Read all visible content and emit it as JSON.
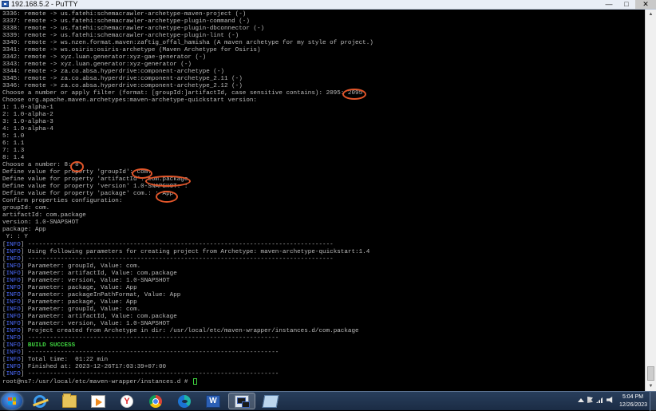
{
  "window": {
    "title": "192.168.5.2 - PuTTY",
    "controls": {
      "minimize": "—",
      "maximize": "□",
      "close": "✕"
    }
  },
  "terminal": {
    "lines": [
      {
        "parts": [
          {
            "text": "3336: remote -> us.fatehi:schemacrawler-archetype-maven-project (-)"
          }
        ]
      },
      {
        "parts": [
          {
            "text": "3337: remote -> us.fatehi:schemacrawler-archetype-plugin-command (-)"
          }
        ]
      },
      {
        "parts": [
          {
            "text": "3338: remote -> us.fatehi:schemacrawler-archetype-plugin-dbconnector (-)"
          }
        ]
      },
      {
        "parts": [
          {
            "text": "3339: remote -> us.fatehi:schemacrawler-archetype-plugin-lint (-)"
          }
        ]
      },
      {
        "parts": [
          {
            "text": "3340: remote -> ws.nzen.format.maven:zaftig_offal_hamisha (A maven archetype for my style of project.)"
          }
        ]
      },
      {
        "parts": [
          {
            "text": "3341: remote -> ws.osiris:osiris-archetype (Maven Archetype for Osiris)"
          }
        ]
      },
      {
        "parts": [
          {
            "text": "3342: remote -> xyz.luan.generator:xyz-gae-generator (-)"
          }
        ]
      },
      {
        "parts": [
          {
            "text": "3343: remote -> xyz.luan.generator:xyz-generator (-)"
          }
        ]
      },
      {
        "parts": [
          {
            "text": "3344: remote -> za.co.absa.hyperdrive:component-archetype (-)"
          }
        ]
      },
      {
        "parts": [
          {
            "text": "3345: remote -> za.co.absa.hyperdrive:component-archetype_2.11 (-)"
          }
        ]
      },
      {
        "parts": [
          {
            "text": "3346: remote -> za.co.absa.hyperdrive:component-archetype_2.12 (-)"
          }
        ]
      },
      {
        "parts": [
          {
            "text": "Choose a number or apply filter (format: [groupId:]artifactId, case sensitive contains): 2095: 2095"
          }
        ]
      },
      {
        "parts": [
          {
            "text": "Choose org.apache.maven.archetypes:maven-archetype-quickstart version:"
          }
        ]
      },
      {
        "parts": [
          {
            "text": "1: 1.0-alpha-1"
          }
        ]
      },
      {
        "parts": [
          {
            "text": "2: 1.0-alpha-2"
          }
        ]
      },
      {
        "parts": [
          {
            "text": "3: 1.0-alpha-3"
          }
        ]
      },
      {
        "parts": [
          {
            "text": "4: 1.0-alpha-4"
          }
        ]
      },
      {
        "parts": [
          {
            "text": "5: 1.0"
          }
        ]
      },
      {
        "parts": [
          {
            "text": "6: 1.1"
          }
        ]
      },
      {
        "parts": [
          {
            "text": "7: 1.3"
          }
        ]
      },
      {
        "parts": [
          {
            "text": "8: 1.4"
          }
        ]
      },
      {
        "parts": [
          {
            "text": "Choose a number: 8: 8"
          }
        ]
      },
      {
        "parts": [
          {
            "text": "Define value for property 'groupId': com."
          }
        ]
      },
      {
        "parts": [
          {
            "text": "Define value for property 'artifactId': com.package"
          }
        ]
      },
      {
        "parts": [
          {
            "text": "Define value for property 'version' 1.0-SNAPSHOT: :"
          }
        ]
      },
      {
        "parts": [
          {
            "text": "Define value for property 'package' com.: : App"
          }
        ]
      },
      {
        "parts": [
          {
            "text": "Confirm properties configuration:"
          }
        ]
      },
      {
        "parts": [
          {
            "text": "groupId: com."
          }
        ]
      },
      {
        "parts": [
          {
            "text": "artifactId: com.package"
          }
        ]
      },
      {
        "parts": [
          {
            "text": "version: 1.0-SNAPSHOT"
          }
        ]
      },
      {
        "parts": [
          {
            "text": "package: App"
          }
        ]
      },
      {
        "parts": [
          {
            "text": " Y: : Y"
          }
        ]
      },
      {
        "parts": [
          {
            "text": "[",
            "cls": ""
          },
          {
            "text": "INFO",
            "cls": "blue"
          },
          {
            "text": "] ------------------------------------------------------------------------------------"
          }
        ]
      },
      {
        "parts": [
          {
            "text": "["
          },
          {
            "text": "INFO",
            "cls": "blue"
          },
          {
            "text": "] Using following parameters for creating project from Archetype: maven-archetype-quickstart:1.4"
          }
        ]
      },
      {
        "parts": [
          {
            "text": "["
          },
          {
            "text": "INFO",
            "cls": "blue"
          },
          {
            "text": "] ------------------------------------------------------------------------------------"
          }
        ]
      },
      {
        "parts": [
          {
            "text": "["
          },
          {
            "text": "INFO",
            "cls": "blue"
          },
          {
            "text": "] Parameter: groupId, Value: com."
          }
        ]
      },
      {
        "parts": [
          {
            "text": "["
          },
          {
            "text": "INFO",
            "cls": "blue"
          },
          {
            "text": "] Parameter: artifactId, Value: com.package"
          }
        ]
      },
      {
        "parts": [
          {
            "text": "["
          },
          {
            "text": "INFO",
            "cls": "blue"
          },
          {
            "text": "] Parameter: version, Value: 1.0-SNAPSHOT"
          }
        ]
      },
      {
        "parts": [
          {
            "text": "["
          },
          {
            "text": "INFO",
            "cls": "blue"
          },
          {
            "text": "] Parameter: package, Value: App"
          }
        ]
      },
      {
        "parts": [
          {
            "text": "["
          },
          {
            "text": "INFO",
            "cls": "blue"
          },
          {
            "text": "] Parameter: packageInPathFormat, Value: App"
          }
        ]
      },
      {
        "parts": [
          {
            "text": "["
          },
          {
            "text": "INFO",
            "cls": "blue"
          },
          {
            "text": "] Parameter: package, Value: App"
          }
        ]
      },
      {
        "parts": [
          {
            "text": "["
          },
          {
            "text": "INFO",
            "cls": "blue"
          },
          {
            "text": "] Parameter: groupId, Value: com."
          }
        ]
      },
      {
        "parts": [
          {
            "text": "["
          },
          {
            "text": "INFO",
            "cls": "blue"
          },
          {
            "text": "] Parameter: artifactId, Value: com.package"
          }
        ]
      },
      {
        "parts": [
          {
            "text": "["
          },
          {
            "text": "INFO",
            "cls": "blue"
          },
          {
            "text": "] Parameter: version, Value: 1.0-SNAPSHOT"
          }
        ]
      },
      {
        "parts": [
          {
            "text": "["
          },
          {
            "text": "INFO",
            "cls": "blue"
          },
          {
            "text": "] Project created from Archetype in dir: /usr/local/etc/maven-wrapper/instances.d/com.package"
          }
        ]
      },
      {
        "parts": [
          {
            "text": "["
          },
          {
            "text": "INFO",
            "cls": "blue"
          },
          {
            "text": "] ---------------------------------------------------------------------"
          }
        ]
      },
      {
        "parts": [
          {
            "text": "["
          },
          {
            "text": "INFO",
            "cls": "blue"
          },
          {
            "text": "] "
          },
          {
            "text": "BUILD SUCCESS",
            "cls": "green"
          }
        ]
      },
      {
        "parts": [
          {
            "text": "["
          },
          {
            "text": "INFO",
            "cls": "blue"
          },
          {
            "text": "] ---------------------------------------------------------------------"
          }
        ]
      },
      {
        "parts": [
          {
            "text": "["
          },
          {
            "text": "INFO",
            "cls": "blue"
          },
          {
            "text": "] Total time:  01:22 min"
          }
        ]
      },
      {
        "parts": [
          {
            "text": "["
          },
          {
            "text": "INFO",
            "cls": "blue"
          },
          {
            "text": "] Finished at: 2023-12-26T17:03:39+07:00"
          }
        ]
      },
      {
        "parts": [
          {
            "text": "["
          },
          {
            "text": "INFO",
            "cls": "blue"
          },
          {
            "text": "] ---------------------------------------------------------------------"
          }
        ]
      },
      {
        "parts": [
          {
            "text": "root@ns7:/usr/local/etc/maven-wrapper/instances.d # "
          }
        ],
        "cursor": true
      }
    ]
  },
  "taskbar": {
    "items": [
      {
        "name": "internet-explorer",
        "icon": "ie-icon",
        "active": false
      },
      {
        "name": "file-explorer",
        "icon": "folder-icon",
        "active": false
      },
      {
        "name": "media-player",
        "icon": "media-player-icon",
        "active": false
      },
      {
        "name": "yandex-browser",
        "icon": "yandex-icon",
        "label": "Y",
        "active": false
      },
      {
        "name": "chrome",
        "icon": "chrome-icon",
        "active": false
      },
      {
        "name": "edge",
        "icon": "edge-icon",
        "active": false
      },
      {
        "name": "word",
        "icon": "word-icon",
        "label": "W",
        "active": false
      },
      {
        "name": "putty",
        "icon": "putty-icon",
        "active": true
      },
      {
        "name": "notepad",
        "icon": "notepad-icon",
        "active": false
      }
    ],
    "clock": {
      "time": "5:04 PM",
      "date": "12/26/2023"
    }
  }
}
